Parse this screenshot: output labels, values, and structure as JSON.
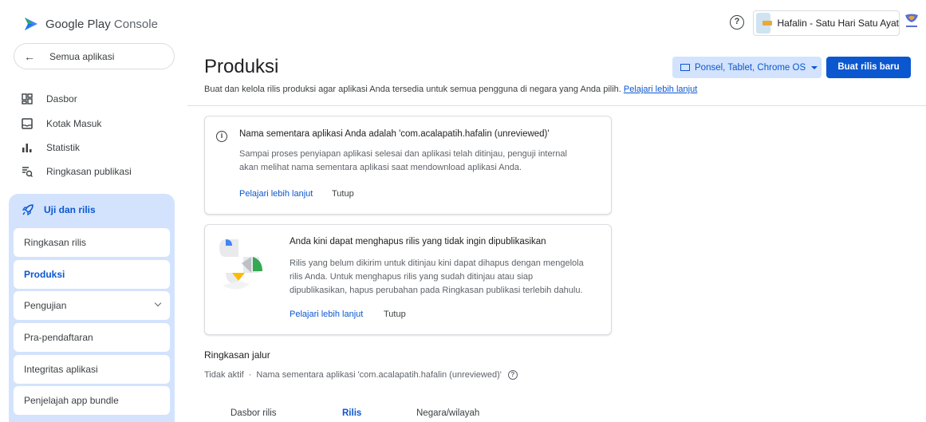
{
  "header": {
    "logo_main": "Google Play",
    "logo_sub": "Console",
    "help_glyph": "?",
    "app_name": "Hafalin - Satu Hari Satu Ayat"
  },
  "sidebar": {
    "back_label": "Semua aplikasi",
    "items": [
      {
        "label": "Dasbor",
        "icon": "dashboard-icon"
      },
      {
        "label": "Kotak Masuk",
        "icon": "inbox-icon"
      },
      {
        "label": "Statistik",
        "icon": "bar-chart-icon"
      },
      {
        "label": "Ringkasan publikasi",
        "icon": "publishing-overview-icon"
      }
    ],
    "group": {
      "label": "Uji dan rilis",
      "icon": "rocket-icon",
      "subitems": [
        {
          "label": "Ringkasan rilis"
        },
        {
          "label": "Produksi",
          "active": true
        },
        {
          "label": "Pengujian",
          "expandable": true
        },
        {
          "label": "Pra-pendaftaran"
        },
        {
          "label": "Integritas aplikasi"
        },
        {
          "label": "Penjelajah app bundle"
        }
      ]
    }
  },
  "main": {
    "title": "Produksi",
    "device_filter": "Ponsel, Tablet, Chrome OS",
    "new_release_button": "Buat rilis baru",
    "subtitle": "Buat dan kelola rilis produksi agar aplikasi Anda tersedia untuk semua pengguna di negara yang Anda pilih.",
    "subtitle_link": "Pelajari lebih lanjut",
    "card1": {
      "title": "Nama sementara aplikasi Anda adalah 'com.acalapatih.hafalin (unreviewed)'",
      "body": "Sampai proses penyiapan aplikasi selesai dan aplikasi telah ditinjau, penguji internal akan melihat nama sementara aplikasi saat mendownload aplikasi Anda.",
      "link": "Pelajari lebih lanjut",
      "close": "Tutup"
    },
    "card2": {
      "title": "Anda kini dapat menghapus rilis yang tidak ingin dipublikasikan",
      "body": "Rilis yang belum dikirim untuk ditinjau kini dapat dihapus dengan mengelola rilis Anda. Untuk menghapus rilis yang sudah ditinjau atau siap dipublikasikan, hapus perubahan pada Ringkasan publikasi terlebih dahulu.",
      "link": "Pelajari lebih lanjut",
      "close": "Tutup"
    },
    "track_summary_title": "Ringkasan jalur",
    "status": "Tidak aktif",
    "status_separator": "·",
    "status_detail": "Nama sementara aplikasi 'com.acalapatih.hafalin (unreviewed)'",
    "tabs": [
      "Dasbor rilis",
      "Rilis",
      "Negara/wilayah"
    ]
  },
  "colors": {
    "accent": "#0b57d0",
    "nav_group_bg": "#d3e3fd"
  }
}
